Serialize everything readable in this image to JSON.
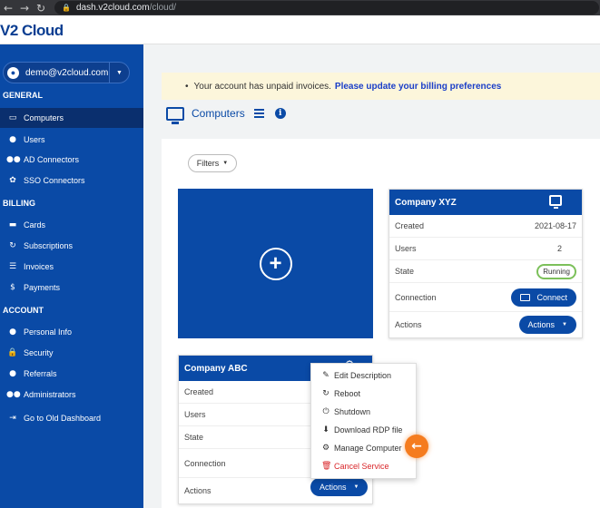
{
  "browser": {
    "back_icon": "←",
    "forward_icon": "→",
    "reload_icon": "↻",
    "url_host": "dash.v2cloud.com",
    "url_path": "/cloud/"
  },
  "header": {
    "logo": "V2 Cloud"
  },
  "sidebar": {
    "account_email": "demo@v2cloud.com",
    "sections": {
      "general": "GENERAL",
      "billing": "BILLING",
      "account": "ACCOUNT"
    },
    "items": {
      "computers": "Computers",
      "users": "Users",
      "ad_connectors": "AD Connectors",
      "sso_connectors": "SSO Connectors",
      "cards": "Cards",
      "subscriptions": "Subscriptions",
      "invoices": "Invoices",
      "payments": "Payments",
      "personal_info": "Personal Info",
      "security": "Security",
      "referrals": "Referrals",
      "administrators": "Administrators",
      "old_dashboard": "Go to Old Dashboard"
    }
  },
  "alert": {
    "text": "Your account has unpaid invoices.",
    "link": "Please update your billing preferences"
  },
  "main": {
    "title": "Computers",
    "filters_label": "Filters"
  },
  "cards": {
    "xyz": {
      "name": "Company XYZ",
      "created_label": "Created",
      "created_value": "2021-08-17",
      "users_label": "Users",
      "users_value": "2",
      "state_label": "State",
      "state_value": "Running",
      "connection_label": "Connection",
      "connect_label": "Connect",
      "actions_label": "Actions",
      "actions_button": "Actions"
    },
    "abc": {
      "name": "Company ABC",
      "created_label": "Created",
      "users_label": "Users",
      "state_label": "State",
      "connection_label": "Connection",
      "actions_label": "Actions",
      "actions_button": "Actions"
    }
  },
  "menu": {
    "edit_description": "Edit Description",
    "reboot": "Reboot",
    "shutdown": "Shutdown",
    "download_rdp": "Download RDP file",
    "manage_computer": "Manage Computer",
    "cancel_service": "Cancel Service"
  },
  "colors": {
    "sidebar": "#0a4aa6",
    "accent": "#0a4aa6",
    "running": "#7cc05a",
    "danger": "#d9262a",
    "highlight": "#f57c1f"
  }
}
